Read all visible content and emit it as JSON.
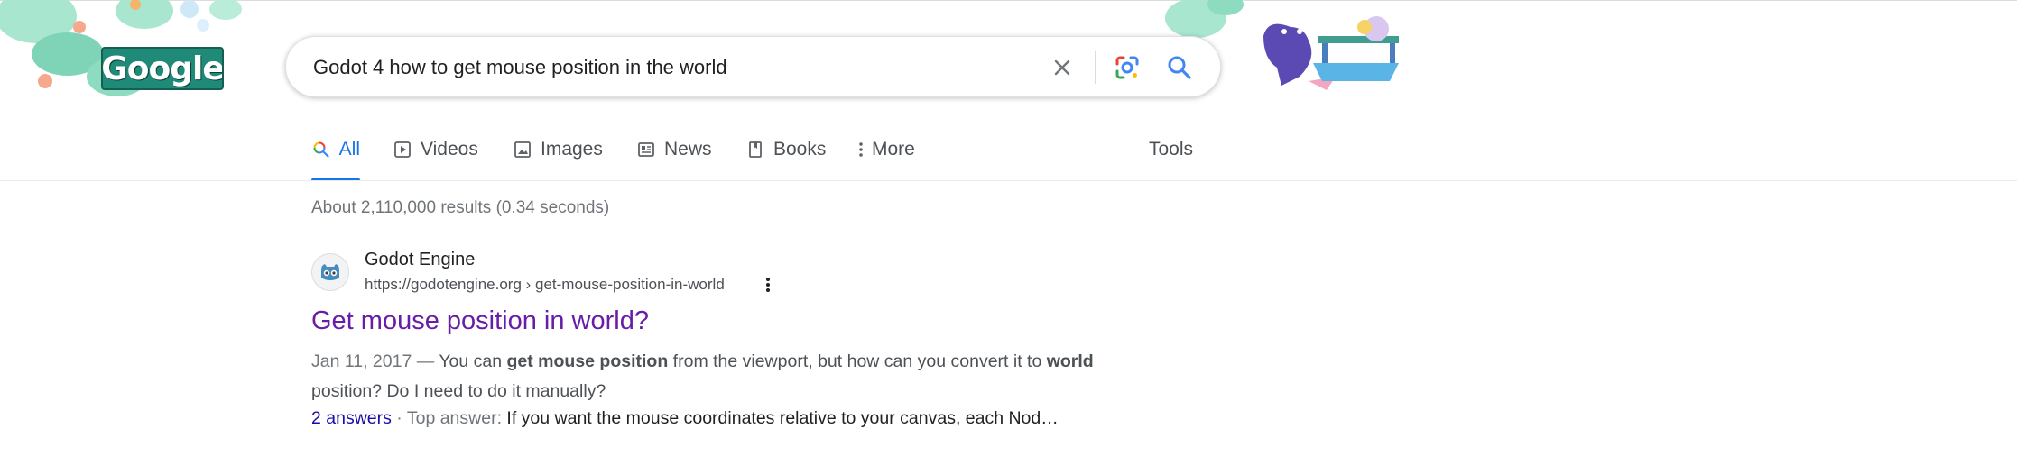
{
  "colors": {
    "accent": "#1a73e8",
    "visited_link": "#681da8",
    "link": "#1a0dab",
    "muted": "#70757a"
  },
  "logo": {
    "text": "Google",
    "icon": "google-doodle-logo"
  },
  "search": {
    "value": "Godot 4 how to get mouse position in the world",
    "clear_icon": "close-icon",
    "lens_icon": "google-lens-icon",
    "search_icon": "search-icon"
  },
  "tabs": [
    {
      "label": "All",
      "icon": "search-icon",
      "active": true
    },
    {
      "label": "Videos",
      "icon": "play-icon",
      "active": false
    },
    {
      "label": "Images",
      "icon": "image-icon",
      "active": false
    },
    {
      "label": "News",
      "icon": "newspaper-icon",
      "active": false
    },
    {
      "label": "Books",
      "icon": "book-icon",
      "active": false
    },
    {
      "label": "More",
      "icon": "more-vert-icon",
      "active": false
    }
  ],
  "tools_label": "Tools",
  "stats": "About 2,110,000 results (0.34 seconds)",
  "result": {
    "site_name": "Godot Engine",
    "url": "https://godotengine.org › get-mouse-position-in-world",
    "title": "Get mouse position in world?",
    "snippet": {
      "date": "Jan 11, 2017",
      "dash": " — ",
      "part1": "You can ",
      "bold1": "get mouse position",
      "part2": " from the viewport, but how can you convert it to ",
      "bold2": "world",
      "part3": " position? Do I need to do it manually?"
    },
    "answers_link": "2 answers",
    "separator": " · ",
    "top_answer_label": "Top answer: ",
    "top_answer_text": "If you want the mouse coordinates relative to your canvas, each Nod…"
  }
}
